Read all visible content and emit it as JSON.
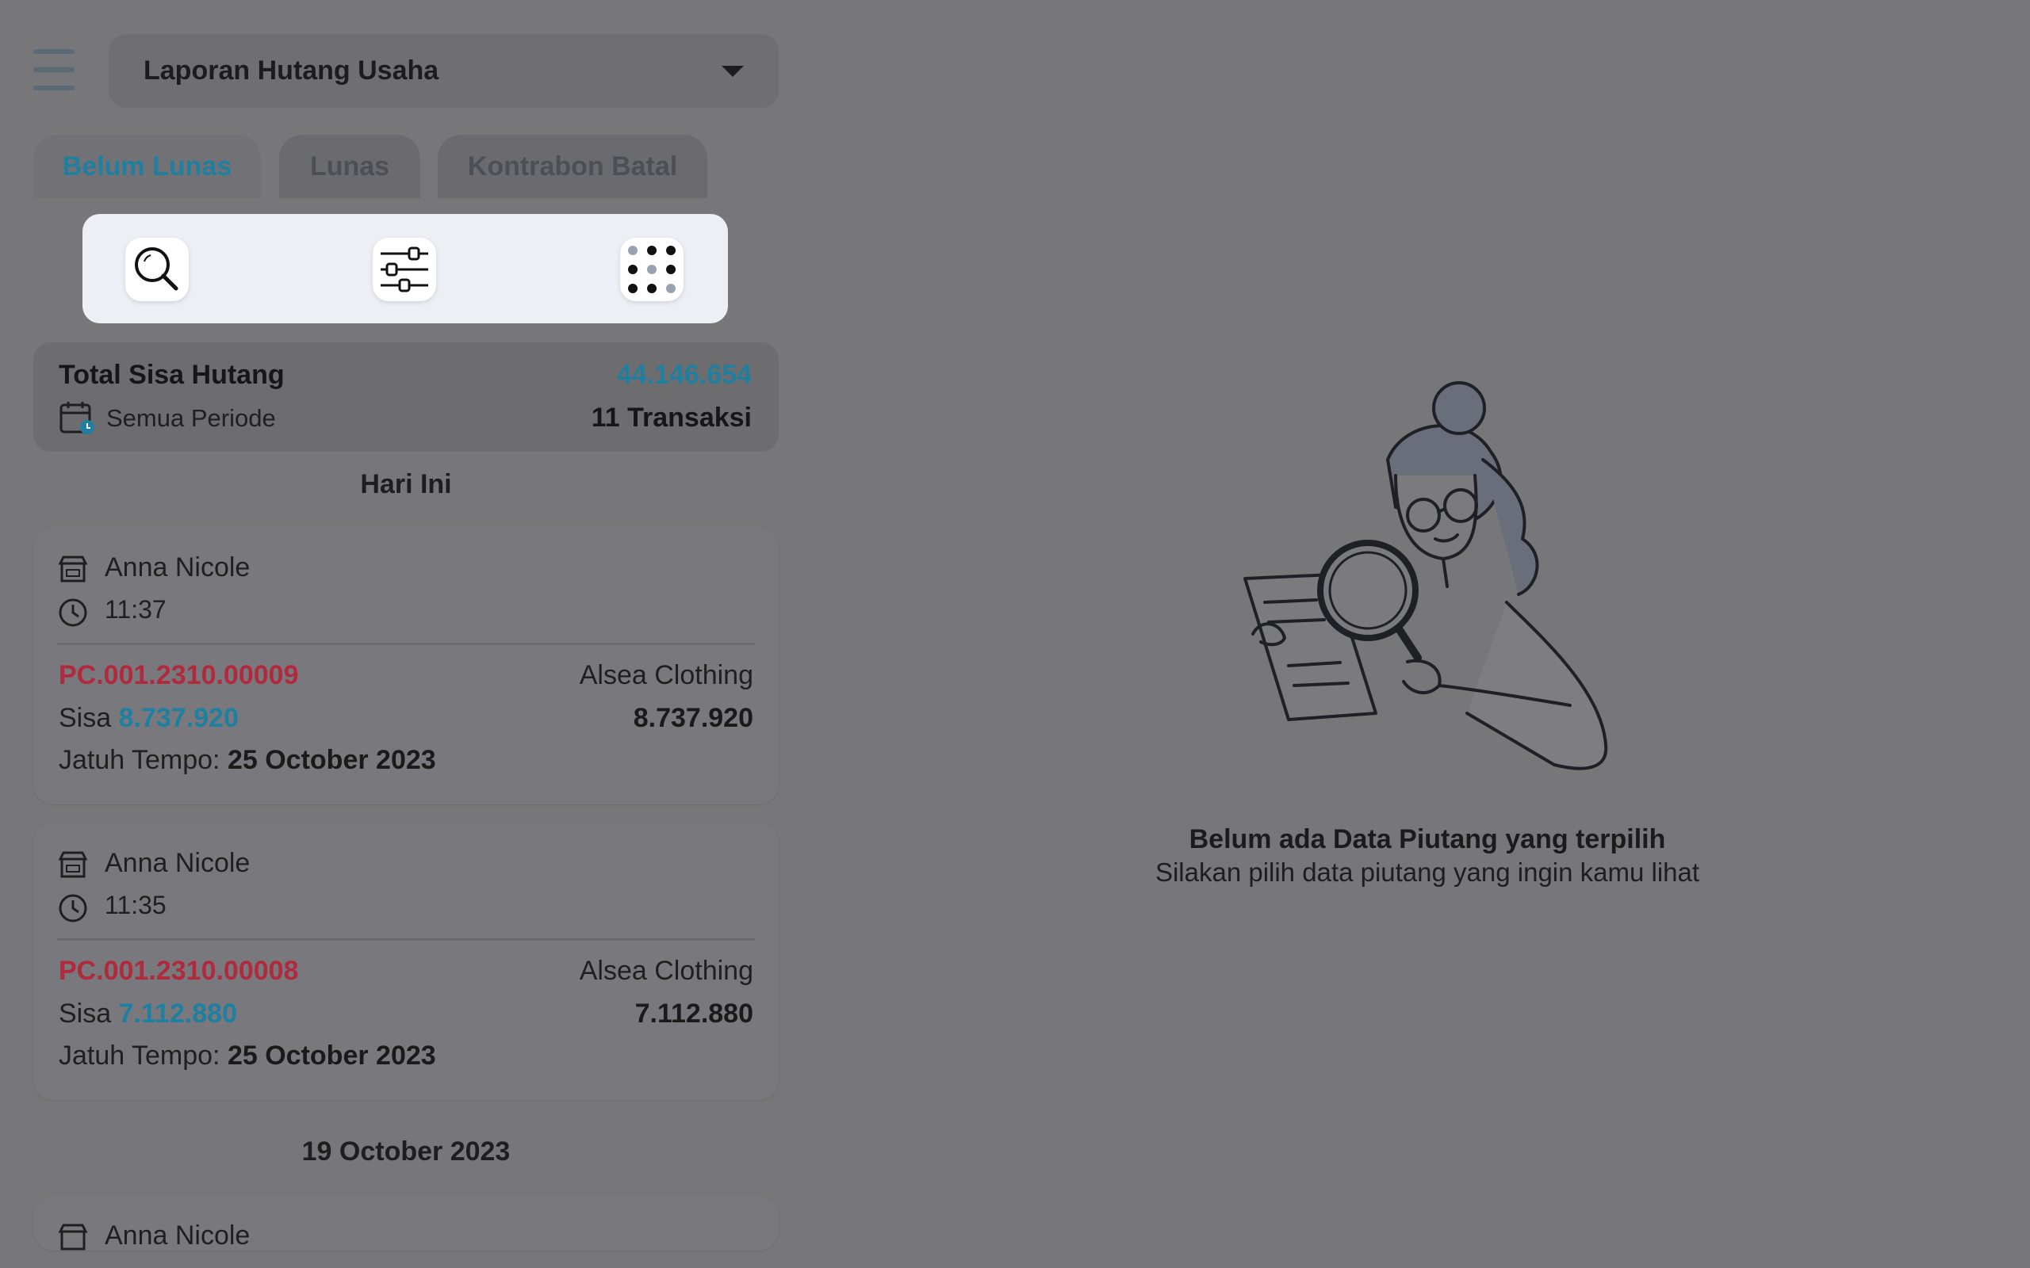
{
  "header": {
    "title": "Laporan Hutang Usaha"
  },
  "tabs": [
    "Belum Lunas",
    "Lunas",
    "Kontrabon Batal"
  ],
  "toolbar": {
    "icons": [
      "search-icon",
      "filter-sliders-icon",
      "grid-dots-icon"
    ]
  },
  "summary": {
    "label": "Total Sisa Hutang",
    "amount": "44.146.654",
    "period": "Semua Periode",
    "count": "11 Transaksi"
  },
  "groups": [
    {
      "date": "Hari Ini",
      "items": [
        {
          "vendor": "Anna Nicole",
          "time": "11:37",
          "code": "PC.001.2310.00009",
          "store": "Alsea Clothing",
          "sisa_label": "Sisa",
          "sisa": "8.737.920",
          "total": "8.737.920",
          "due_label": "Jatuh Tempo:",
          "due": "25 October 2023"
        },
        {
          "vendor": "Anna Nicole",
          "time": "11:35",
          "code": "PC.001.2310.00008",
          "store": "Alsea Clothing",
          "sisa_label": "Sisa",
          "sisa": "7.112.880",
          "total": "7.112.880",
          "due_label": "Jatuh Tempo:",
          "due": "25 October 2023"
        }
      ]
    },
    {
      "date": "19 October 2023",
      "items": [
        {
          "vendor": "Anna Nicole"
        }
      ]
    }
  ],
  "empty_state": {
    "title": "Belum ada Data Piutang yang terpilih",
    "subtitle": "Silakan pilih data piutang yang ingin kamu lihat"
  }
}
